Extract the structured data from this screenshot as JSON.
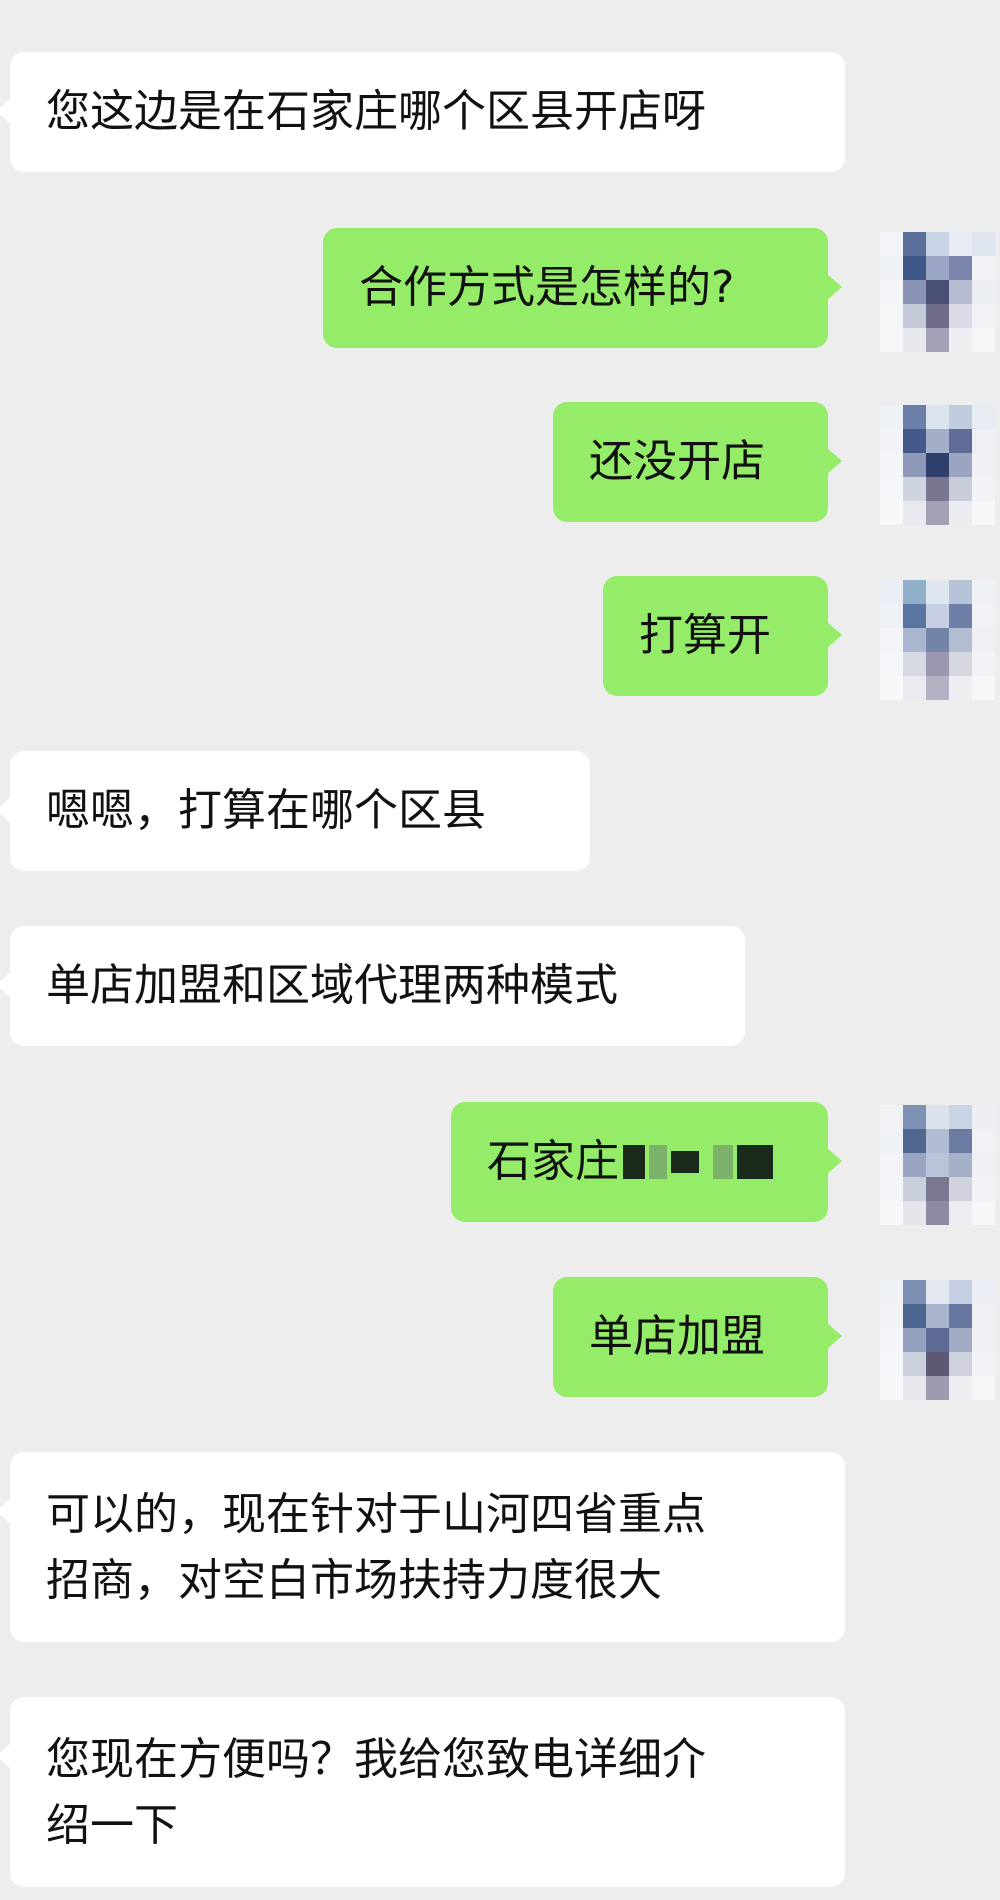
{
  "messages": [
    {
      "side": "incoming",
      "text": "您这边是在石家庄哪个区县开店呀"
    },
    {
      "side": "outgoing",
      "text": "合作方式是怎样的?"
    },
    {
      "side": "outgoing",
      "text": "还没开店"
    },
    {
      "side": "outgoing",
      "text": "打算开"
    },
    {
      "side": "incoming",
      "text": "嗯嗯，打算在哪个区县"
    },
    {
      "side": "incoming",
      "text": "单店加盟和区域代理两种模式"
    },
    {
      "side": "outgoing",
      "text": "石家庄"
    },
    {
      "side": "outgoing",
      "text": "单店加盟"
    },
    {
      "side": "incoming",
      "lines": [
        "可以的，现在针对于山河四省重点",
        "招商，对空白市场扶持力度很大"
      ]
    },
    {
      "side": "incoming",
      "lines": [
        "您现在方便吗？我给您致电详细介",
        "绍一下"
      ]
    }
  ],
  "colors": {
    "background": "#ededed",
    "incoming_bubble": "#ffffff",
    "outgoing_bubble": "#95ec69",
    "text": "#111111"
  },
  "avatar": {
    "icon": "pixelated-avatar-icon"
  }
}
